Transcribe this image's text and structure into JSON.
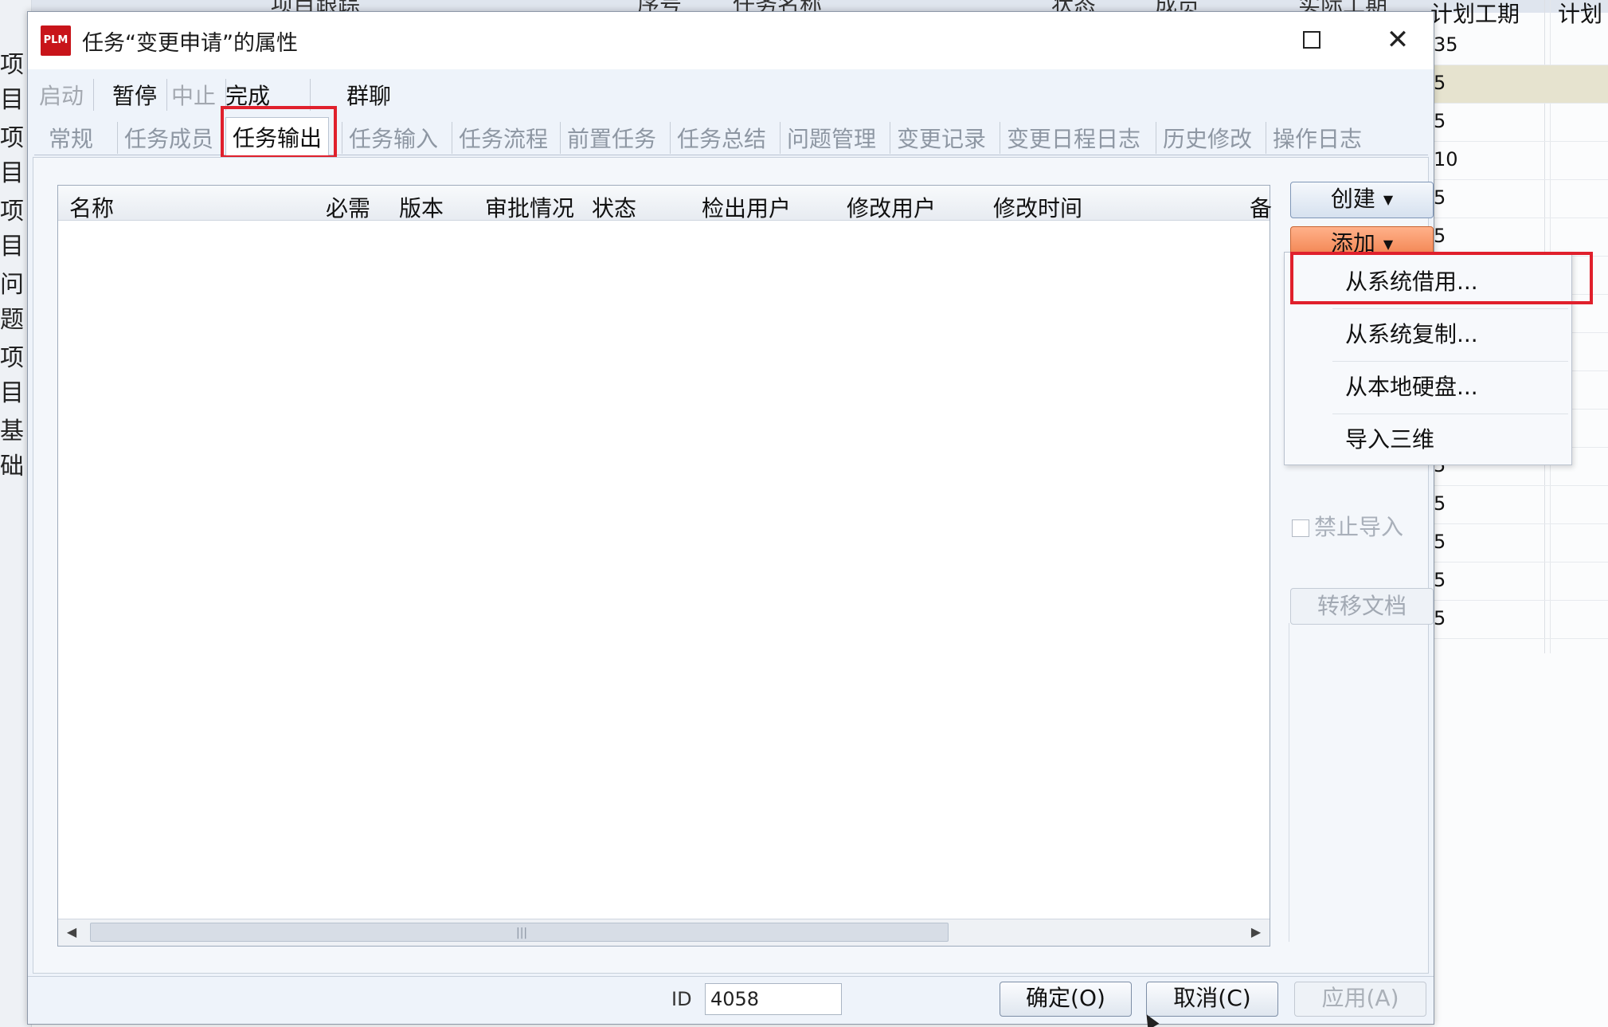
{
  "background": {
    "left_items": [
      "项目",
      "项目",
      "项目",
      "问题",
      "项目",
      "基础"
    ],
    "top_labels": [
      "项目跟踪",
      "序号",
      "任务名称",
      "状态",
      "成员",
      "实际工期"
    ],
    "grid_head": [
      "计划工期",
      "计划"
    ],
    "grid_rows": [
      "35",
      "5",
      "5",
      "10",
      "5",
      "5",
      "",
      "",
      "",
      "",
      "",
      "",
      "5",
      "5",
      "5",
      "5",
      "5"
    ]
  },
  "dialog": {
    "logo_text": "PLM",
    "title": "任务“变更申请”的属性",
    "maximize_label": "",
    "close_label": "✕",
    "toolbar": [
      "启动",
      "暂停",
      "中止",
      "完成",
      "群聊"
    ],
    "tabs": [
      "常规",
      "任务成员",
      "任务输出",
      "任务输入",
      "任务流程",
      "前置任务",
      "任务总结",
      "问题管理",
      "变更记录",
      "变更日程日志",
      "历史修改",
      "操作日志"
    ],
    "active_tab": "任务输出",
    "columns": [
      "名称",
      "必需",
      "版本",
      "审批情况",
      "状态",
      "检出用户",
      "修改用户",
      "修改时间",
      "备"
    ],
    "create_label": "创建",
    "add_label": "添加",
    "menu_items": [
      "从系统借用...",
      "从系统复制...",
      "从本地硬盘...",
      "导入三维"
    ],
    "ghost_checkbox_label": "禁止导入",
    "move_label": "转移文档",
    "id_label": "ID",
    "id_value": "4058",
    "ok_label": "确定(O)",
    "cancel_label": "取消(C)",
    "apply_label": "应用(A)",
    "accent_color": "#e0202c",
    "add_color": "#ef7a44"
  }
}
